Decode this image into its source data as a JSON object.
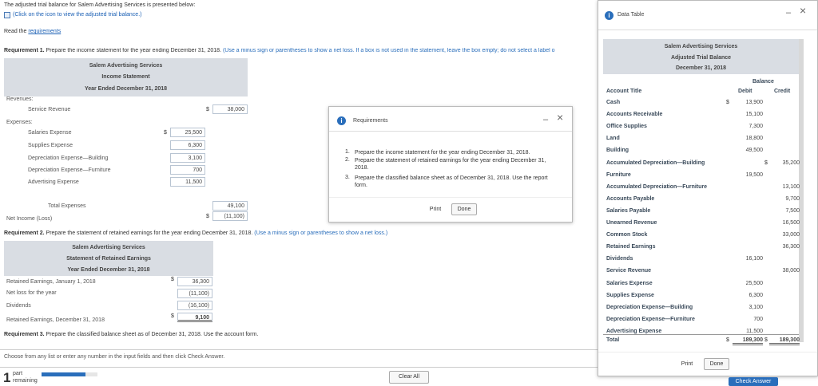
{
  "intro": "The adjusted trial balance for Salem Advertising Services is presented below:",
  "view_link": "(Click on the icon to view the adjusted trial balance.)",
  "read_prefix": "Read the",
  "read_link": "requirements",
  "req1_bold": "Requirement 1.",
  "req1_text": "Prepare the income statement for the year ending December 31, 2018.",
  "req1_hint": "(Use a minus sign or parentheses to show a net loss. If a box is not used in the statement, leave the box empty; do not select a label o",
  "income": {
    "company": "Salem Advertising Services",
    "title": "Income Statement",
    "period": "Year Ended December 31, 2018",
    "revenues_label": "Revenues:",
    "service_revenue_label": "Service Revenue",
    "service_revenue_dollar": "$",
    "service_revenue_value": "38,000",
    "expenses_label": "Expenses:",
    "salaries_label": "Salaries Expense",
    "salaries_dollar": "$",
    "salaries_value": "25,500",
    "supplies_label": "Supplies Expense",
    "supplies_value": "6,300",
    "dep_building_label": "Depreciation Expense—Building",
    "dep_building_value": "3,100",
    "dep_furniture_label": "Depreciation Expense—Furniture",
    "dep_furniture_value": "700",
    "advertising_label": "Advertising Expense",
    "advertising_value": "11,500",
    "total_exp_label": "Total Expenses",
    "total_exp_value": "49,100",
    "net_income_label": "Net Income (Loss)",
    "net_income_dollar": "$",
    "net_income_value": "(11,100)"
  },
  "req2_bold": "Requirement 2.",
  "req2_text": "Prepare the statement of retained earnings for the year ending December 31, 2018.",
  "req2_hint": "(Use a minus sign or parentheses to show a net loss.)",
  "retained": {
    "company": "Salem Advertising Services",
    "title": "Statement of Retained Earnings",
    "period": "Year Ended December 31, 2018",
    "beginning_label": "Retained Earnings, January 1, 2018",
    "beginning_dollar": "$",
    "beginning_value": "36,300",
    "netloss_label": "Net loss for the year",
    "netloss_value": "(11,100)",
    "dividends_label": "Dividends",
    "dividends_value": "(16,100)",
    "ending_label": "Retained Earnings, December 31, 2018",
    "ending_dollar": "$",
    "ending_value": "9,100"
  },
  "req3_bold": "Requirement 3.",
  "req3_text": "Prepare the classified balance sheet as of December 31, 2018. Use the account form.",
  "footer_instruction": "Choose from any list or enter any number in the input fields and then click Check Answer.",
  "parts_number": "1",
  "parts_word": "part",
  "parts_remaining": "remaining",
  "clear_all": "Clear All",
  "check_answer": "Check Answer",
  "requirements_modal": {
    "title": "Requirements",
    "items": [
      {
        "num": "1.",
        "text": "Prepare the income statement for the year ending December 31, 2018."
      },
      {
        "num": "2.",
        "text": "Prepare the statement of retained earnings for the year ending December 31, 2018."
      },
      {
        "num": "3.",
        "text": "Prepare the classified balance sheet as of December 31, 2018. Use the report form."
      }
    ],
    "print": "Print",
    "done": "Done"
  },
  "data_table_modal": {
    "title": "Data Table",
    "company": "Salem Advertising Services",
    "subtitle": "Adjusted Trial Balance",
    "date": "December 31, 2018",
    "balance_header": "Balance",
    "account_title_header": "Account Title",
    "debit_header": "Debit",
    "credit_header": "Credit",
    "rows": [
      {
        "account": "Cash",
        "dsign": "$",
        "debit": "13,900",
        "csign": "",
        "credit": ""
      },
      {
        "account": "Accounts Receivable",
        "dsign": "",
        "debit": "15,100",
        "csign": "",
        "credit": ""
      },
      {
        "account": "Office Supplies",
        "dsign": "",
        "debit": "7,300",
        "csign": "",
        "credit": ""
      },
      {
        "account": "Land",
        "dsign": "",
        "debit": "18,800",
        "csign": "",
        "credit": ""
      },
      {
        "account": "Building",
        "dsign": "",
        "debit": "49,500",
        "csign": "",
        "credit": ""
      },
      {
        "account": "Accumulated Depreciation—Building",
        "dsign": "",
        "debit": "",
        "csign": "$",
        "credit": "35,200"
      },
      {
        "account": "Furniture",
        "dsign": "",
        "debit": "19,500",
        "csign": "",
        "credit": ""
      },
      {
        "account": "Accumulated Depreciation—Furniture",
        "dsign": "",
        "debit": "",
        "csign": "",
        "credit": "13,100"
      },
      {
        "account": "Accounts Payable",
        "dsign": "",
        "debit": "",
        "csign": "",
        "credit": "9,700"
      },
      {
        "account": "Salaries Payable",
        "dsign": "",
        "debit": "",
        "csign": "",
        "credit": "7,500"
      },
      {
        "account": "Unearned Revenue",
        "dsign": "",
        "debit": "",
        "csign": "",
        "credit": "16,500"
      },
      {
        "account": "Common Stock",
        "dsign": "",
        "debit": "",
        "csign": "",
        "credit": "33,000"
      },
      {
        "account": "Retained Earnings",
        "dsign": "",
        "debit": "",
        "csign": "",
        "credit": "36,300"
      },
      {
        "account": "Dividends",
        "dsign": "",
        "debit": "16,100",
        "csign": "",
        "credit": ""
      },
      {
        "account": "Service Revenue",
        "dsign": "",
        "debit": "",
        "csign": "",
        "credit": "38,000"
      },
      {
        "account": "Salaries Expense",
        "dsign": "",
        "debit": "25,500",
        "csign": "",
        "credit": ""
      },
      {
        "account": "Supplies Expense",
        "dsign": "",
        "debit": "6,300",
        "csign": "",
        "credit": ""
      },
      {
        "account": "Depreciation Expense—Building",
        "dsign": "",
        "debit": "3,100",
        "csign": "",
        "credit": ""
      },
      {
        "account": "Depreciation Expense—Furniture",
        "dsign": "",
        "debit": "700",
        "csign": "",
        "credit": ""
      },
      {
        "account": "Advertising Expense",
        "dsign": "",
        "debit": "11,500",
        "csign": "",
        "credit": ""
      }
    ],
    "total_label": "Total",
    "total_dsign": "$",
    "total_debit": "189,300",
    "total_csign": "$",
    "total_credit": "189,300",
    "print": "Print",
    "done": "Done"
  },
  "icons": {
    "info": "i",
    "minimize": "–",
    "close": "×"
  },
  "colors": {
    "accent": "#2a6ebb",
    "header_gray": "#d9dde3",
    "progress": "#2a6ebb"
  }
}
